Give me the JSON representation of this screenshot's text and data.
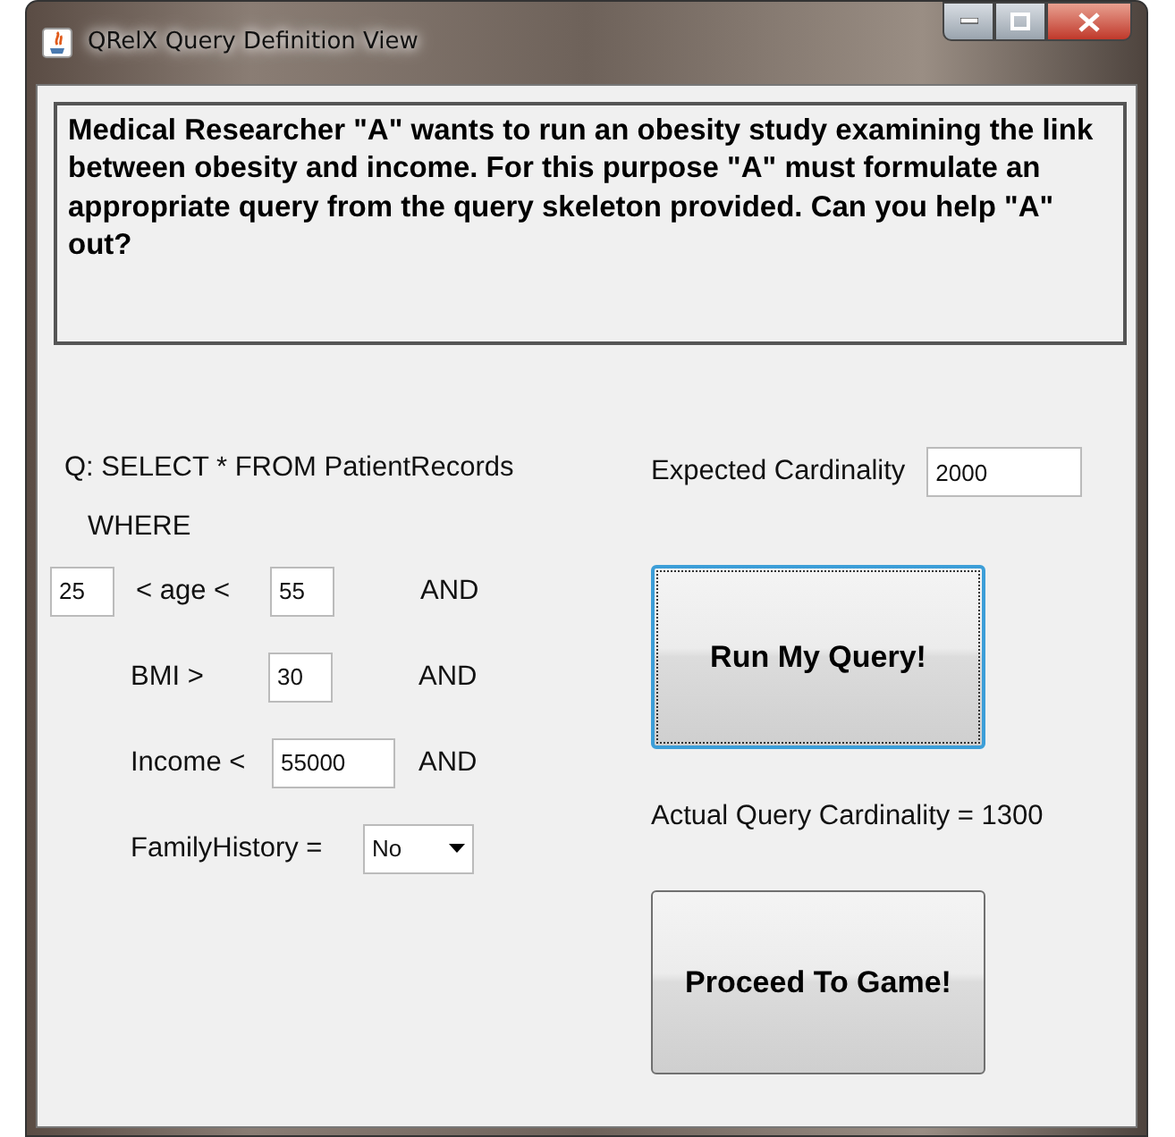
{
  "window": {
    "title": "QRelX Query Definition View"
  },
  "description": "Medical Researcher \"A\" wants to run an obesity study examining the link between obesity and income. For this purpose \"A\" must formulate an appropriate query from the query skeleton provided. Can you help \"A\" out?",
  "query": {
    "prefix": "Q: SELECT * FROM PatientRecords",
    "where": "WHERE",
    "conditions": [
      {
        "kind": "range",
        "low_value": "25",
        "label": "< age <",
        "value": "55",
        "connector": "AND"
      },
      {
        "kind": "compare",
        "label": "BMI >",
        "value": "30",
        "connector": "AND"
      },
      {
        "kind": "compare",
        "label": "Income <",
        "value": "55000",
        "connector": "AND"
      },
      {
        "kind": "select",
        "label": "FamilyHistory =",
        "value": "No"
      }
    ]
  },
  "expected_cardinality": {
    "label": "Expected Cardinality",
    "value": "2000"
  },
  "run_button": {
    "label": "Run My Query!",
    "focused": true
  },
  "actual_cardinality": "Actual Query Cardinality = 1300",
  "proceed_button": {
    "label": "Proceed To Game!",
    "focused": false
  }
}
